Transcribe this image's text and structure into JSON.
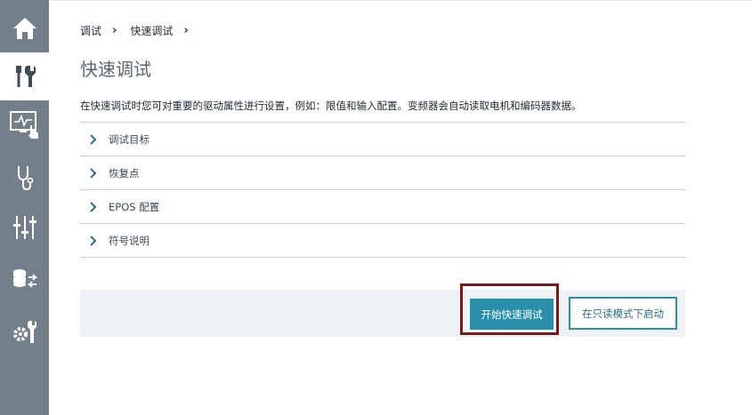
{
  "sidebar": {
    "items": [
      {
        "icon": "home-icon",
        "active": false
      },
      {
        "icon": "tools-icon",
        "active": true
      },
      {
        "icon": "monitor-touch-icon",
        "active": false
      },
      {
        "icon": "stethoscope-icon",
        "active": false
      },
      {
        "icon": "sliders-icon",
        "active": false
      },
      {
        "icon": "database-transfer-icon",
        "active": false
      },
      {
        "icon": "gear-wrench-icon",
        "active": false
      }
    ],
    "background": "#737f8a"
  },
  "breadcrumb": {
    "items": [
      "调试",
      "快速调试"
    ],
    "separator": "›"
  },
  "page": {
    "title": "快速调试",
    "description": "在快速调试时您可对重要的驱动属性进行设置，例如：限值和输入配置。变频器会自动读取电机和编码器数据。"
  },
  "accordion": {
    "items": [
      {
        "label": "调试目标"
      },
      {
        "label": "恢复点"
      },
      {
        "label": "EPOS 配置"
      },
      {
        "label": "符号说明"
      }
    ]
  },
  "footer": {
    "start_button": "开始快速调试",
    "readonly_button": "在只读模式下启动"
  },
  "colors": {
    "accent": "#2a8fab",
    "highlight": "#7a1b1b"
  }
}
